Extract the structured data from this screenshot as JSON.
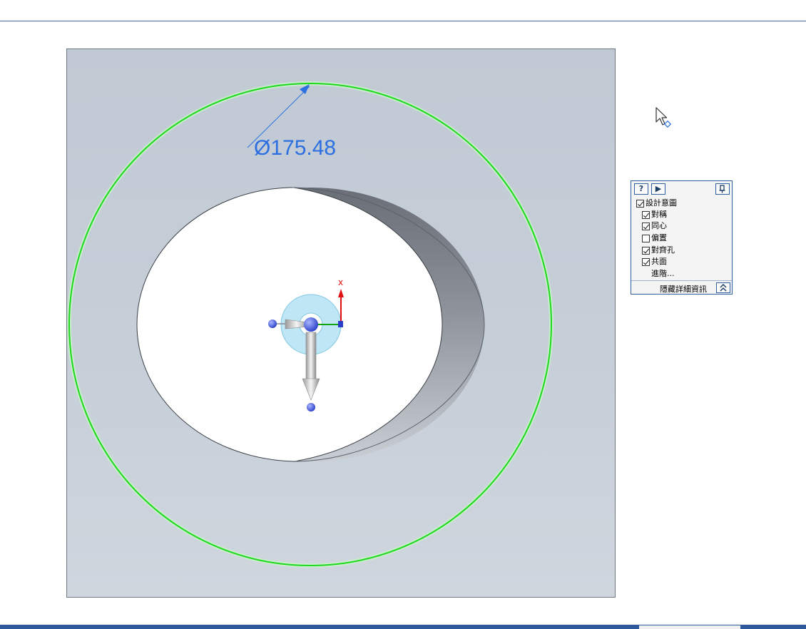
{
  "viewport": {
    "dimension_value": "Ø175.48",
    "colors": {
      "selection_circle": "#1fd81f",
      "dimension": "#2b6fe0",
      "triad_ring": "#bfe6f5"
    }
  },
  "intent_panel": {
    "help_label": "?",
    "play_label": "▶",
    "items": [
      {
        "label": "設計意圖",
        "checked": true
      },
      {
        "label": "對稱",
        "checked": true
      },
      {
        "label": "同心",
        "checked": true
      },
      {
        "label": "偏置",
        "checked": false
      },
      {
        "label": "對齊孔",
        "checked": true
      },
      {
        "label": "共面",
        "checked": true
      }
    ],
    "advanced_label": "進階...",
    "hide_details_label": "隱藏詳細資訊"
  },
  "icons": [
    "pin-icon",
    "cursor-icon",
    "collapse-chevron-icon",
    "steering-wheel-icon"
  ]
}
